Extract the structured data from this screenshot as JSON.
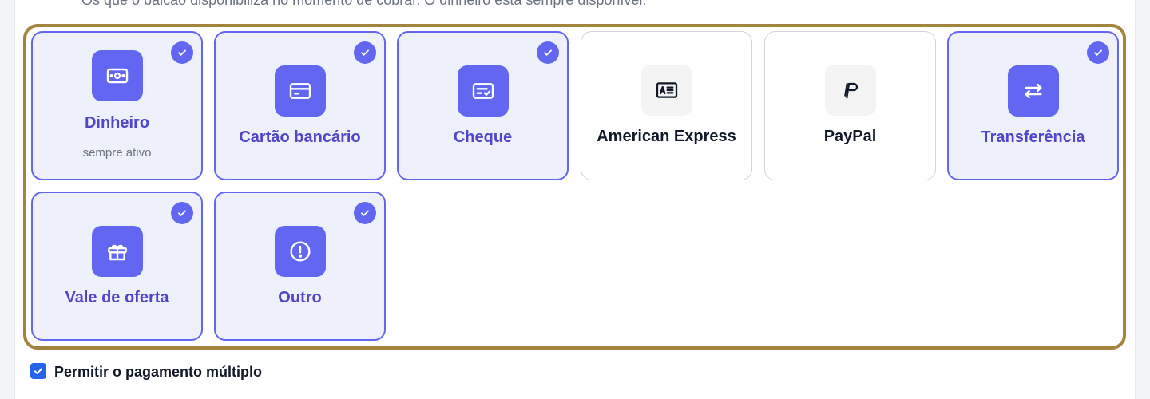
{
  "description": "Os que o balcão disponibiliza no momento de cobrar. O dinheiro está sempre disponível.",
  "methods": [
    {
      "label": "Dinheiro",
      "sub": "sempre ativo",
      "selected": true,
      "icon": "cash-icon"
    },
    {
      "label": "Cartão bancário",
      "selected": true,
      "icon": "credit-card-icon"
    },
    {
      "label": "Cheque",
      "selected": true,
      "icon": "cheque-icon"
    },
    {
      "label": "American Express",
      "selected": false,
      "icon": "amex-card-icon"
    },
    {
      "label": "PayPal",
      "selected": false,
      "icon": "paypal-icon"
    },
    {
      "label": "Transferência",
      "selected": true,
      "icon": "transfer-icon"
    },
    {
      "label": "Vale de oferta",
      "selected": true,
      "icon": "gift-icon"
    },
    {
      "label": "Outro",
      "selected": true,
      "icon": "alert-circle-icon"
    }
  ],
  "allow_multiple": {
    "label": "Permitir o pagamento múltiplo",
    "checked": true
  },
  "colors": {
    "accent": "#6366f1",
    "accent_text": "#4f46c8",
    "selected_bg": "#eef0fc",
    "highlight_border": "#a3843f"
  }
}
